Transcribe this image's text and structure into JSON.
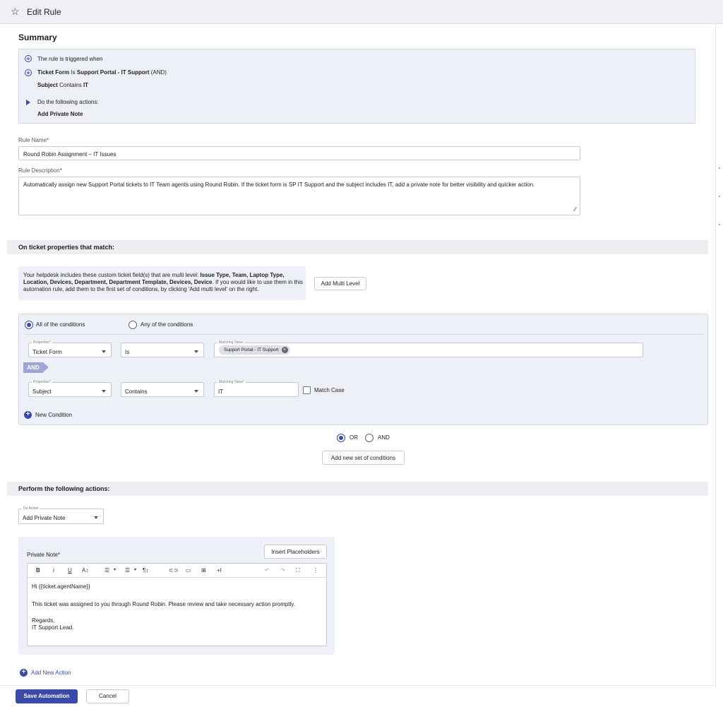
{
  "header": {
    "title": "Edit Rule"
  },
  "summary": {
    "heading": "Summary",
    "triggered_text": "The rule is triggered when",
    "cond1_field": "Ticket Form",
    "cond1_op": " Is ",
    "cond1_value": "Support Portal - IT Support",
    "cond1_join": " (AND)",
    "cond2_field": "Subject",
    "cond2_op": " Contains ",
    "cond2_value": "IT",
    "actions_text": "Do the following actions:",
    "action_value": "Add Private Note"
  },
  "rule_name": {
    "label": "Rule Name*",
    "value": "Round Robin Assignment – IT Issues"
  },
  "rule_description": {
    "label": "Rule Description*",
    "value": "Automatically assign new Support Portal tickets to IT Team agents using Round Robin. If the ticket form is SP IT Support and the subject includes IT, add a private note for better visibility and quicker action."
  },
  "conditions_section": {
    "title": "On ticket properties that match:",
    "info_prefix": "Your helpdesk includes these custom ticket field(s) that are multi level: ",
    "info_fields": "Issue Type, Team, Laptop Type, Location, Devices, Department, Department Template, Devices, Device",
    "info_suffix": ". If you would like to use them in this automation rule, add them to the first set of conditions, by clicking 'Add multi level' on the right.",
    "add_multi_level": "Add Multi Level",
    "all_label": "All of the conditions",
    "any_label": "Any of the conditions",
    "row1": {
      "prop_label": "Properties*",
      "prop": "Ticket Form",
      "op": "Is",
      "match_label": "Matching Value",
      "chip": "Support Portal - IT Support"
    },
    "and_tag": "AND",
    "row2": {
      "prop_label": "Properties*",
      "prop": "Subject",
      "op": "Contains",
      "match_label": "Matching Value*",
      "value": "IT",
      "match_case": "Match Case"
    },
    "new_condition": "New Condition",
    "or_label": "OR",
    "and_label": "AND",
    "add_set": "Add new set of conditions"
  },
  "actions_section": {
    "title": "Perform the following actions:",
    "do_action_label": "Do Action",
    "do_action_value": "Add Private Note",
    "private_note_label": "Private Note*",
    "insert_placeholders": "Insert Placeholders",
    "toolbar": [
      "B",
      "i",
      "U",
      "A↕",
      "☰",
      "▾",
      "☰",
      "▾",
      "¶↕",
      "⊂⊃",
      "▭",
      "⊞",
      "+I",
      "↶",
      "↷",
      "⛶",
      "⋮"
    ],
    "editor_lines": [
      "Hi {{ticket.agentName}}",
      "This ticket was assigned to you through Round Robin. Please review and take necessary action promptly.",
      "Regards,",
      "IT Support Lead."
    ],
    "add_new_action": "Add New Action"
  },
  "footer": {
    "save": "Save Automation",
    "cancel": "Cancel"
  },
  "colors": {
    "accent": "#3b49a8",
    "panel": "#eef0f7",
    "and_tag": "#9ea7d3"
  }
}
